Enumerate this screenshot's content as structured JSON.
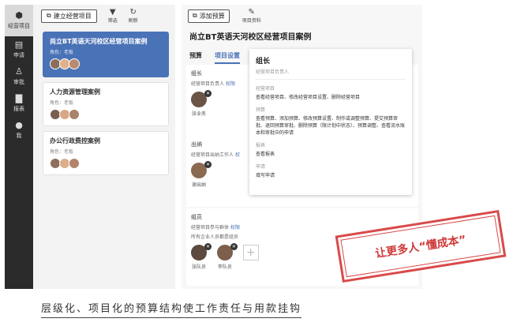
{
  "sidebar": {
    "items": [
      {
        "label": "经营项目",
        "icon": "cube-icon"
      },
      {
        "label": "申请",
        "icon": "document-icon"
      },
      {
        "label": "审批",
        "icon": "stamp-icon"
      },
      {
        "label": "报表",
        "icon": "bar-chart-icon"
      },
      {
        "label": "我",
        "icon": "user-icon"
      }
    ]
  },
  "left_toolbar": {
    "new_button": "建立经营项目",
    "filter": "筛选",
    "refresh": "刷新"
  },
  "cases": [
    {
      "title": "尚立BT英语天河校区经营项目案例",
      "role": "角色：老板"
    },
    {
      "title": "人力资源管理案例",
      "role": "角色：老板"
    },
    {
      "title": "办公行政费控案例",
      "role": "角色：老板"
    }
  ],
  "right_toolbar": {
    "add_budget": "添加预算",
    "project_info": "项目资料"
  },
  "project_title": "尚立BT英语天河校区经营项目案例",
  "tabs": [
    {
      "label": "预算"
    },
    {
      "label": "项目设置"
    }
  ],
  "sections": {
    "leader": {
      "title": "组长",
      "desc": "经营项目负责人",
      "link": "权限",
      "members": [
        {
          "name": "张业务"
        }
      ]
    },
    "cashier": {
      "title": "出纳",
      "desc": "经营项目出纳工作人",
      "link": "权",
      "members": [
        {
          "name": "谢出纳"
        }
      ]
    },
    "group": {
      "title": "组员",
      "desc": "经营项目参与群体",
      "link": "权限",
      "note": "所有企业人员都是组员",
      "members": [
        {
          "name": "张队员"
        },
        {
          "name": "李队员"
        }
      ]
    }
  },
  "popover": {
    "title": "组长",
    "subtitle": "经营项目负责人",
    "groups": [
      {
        "heading": "经营项目",
        "text": "查看经营项目、修改经营项目设置、删除经营项目"
      },
      {
        "heading": "预算",
        "text": "查看预算、添加预算、修改预算设置、制作或调整预算、提交预算审批、退回预算审批、删除预算（限计划中状态）、预算调整、查看流水账本和审批中的申请"
      },
      {
        "heading": "报表",
        "text": "查看报表"
      },
      {
        "heading": "申请",
        "text": "填写申请"
      }
    ]
  },
  "stamp_text": "让更多人“懂成本”",
  "caption": "层级化、项目化的预算结构使工作责任与用款挂钩",
  "colors": {
    "accent": "#4a72b6",
    "stamp": "#d94a4a",
    "sidebar": "#2b2b2b"
  }
}
